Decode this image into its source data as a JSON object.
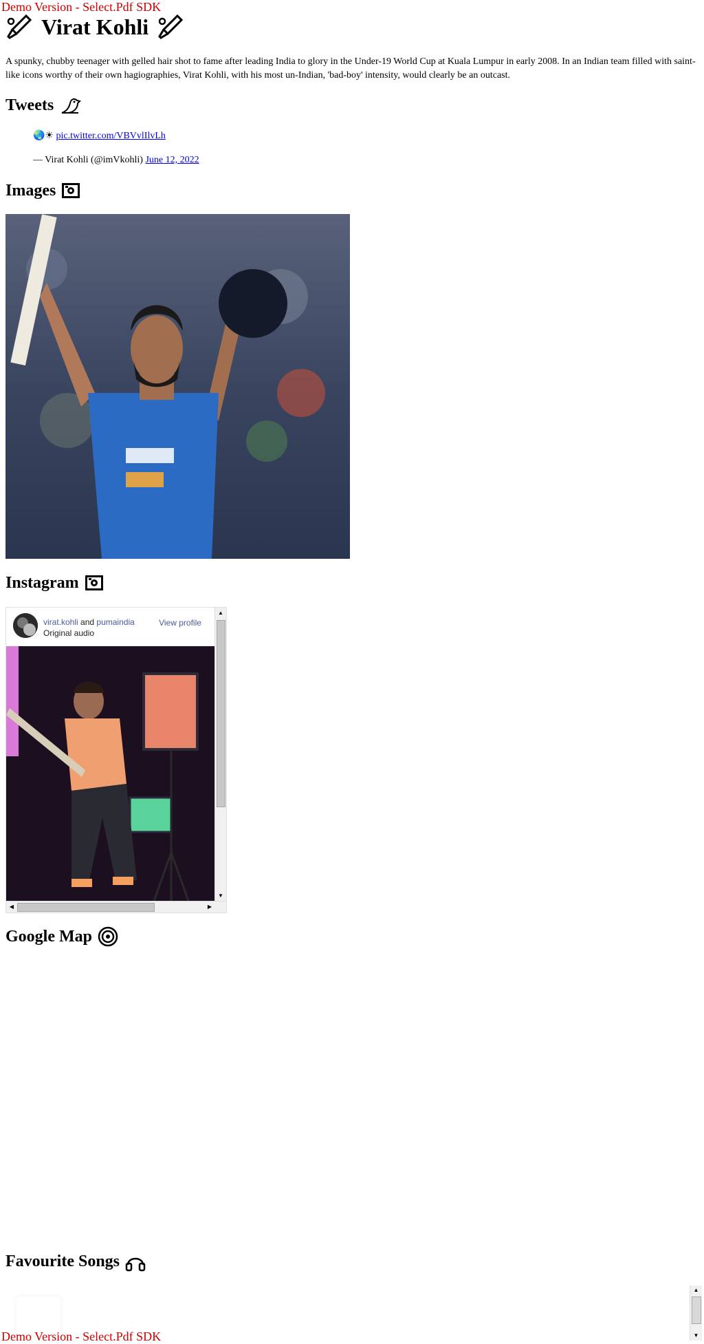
{
  "watermark": "Demo Version - Select.Pdf SDK",
  "title": "Virat Kohli",
  "intro": "A spunky, chubby teenager with gelled hair shot to fame after leading India to glory in the Under-19 World Cup at Kuala Lumpur in early 2008. In an Indian team filled with saint-like icons worthy of their own hagiographies, Virat Kohli, with his most un-Indian, 'bad-boy' intensity, would clearly be an outcast.",
  "sections": {
    "tweets": "Tweets",
    "images": "Images",
    "instagram": "Instagram",
    "google_map": "Google Map",
    "favourite_songs": "Favourite Songs"
  },
  "tweet": {
    "link": "pic.twitter.com/VBVvlIlvLh",
    "attribution": "— Virat Kohli (@imVkohli)",
    "date": "June 12, 2022"
  },
  "instagram": {
    "user": "virat.kohli",
    "and": "and",
    "collab": "pumaindia",
    "audio": "Original audio",
    "view_profile": "View profile"
  },
  "icons": {
    "title": "cricket-bat-icon",
    "tweets": "bird-icon",
    "images": "camera-icon",
    "instagram": "camera-icon",
    "google_map": "map-target-icon",
    "favourite_songs": "headphones-icon"
  },
  "colors": {
    "watermark": "#cc0000",
    "link": "#0000ee",
    "insta_link": "#4a5a9e"
  }
}
